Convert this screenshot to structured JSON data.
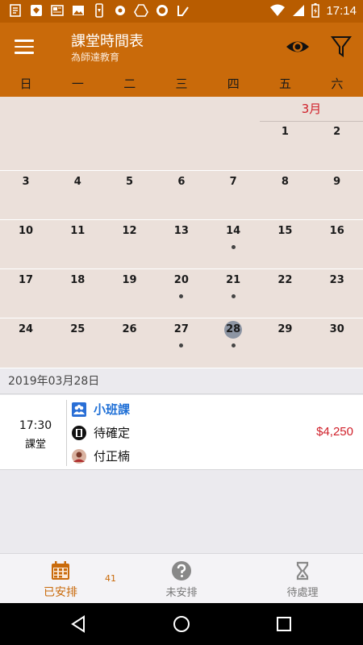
{
  "status_bar": {
    "time": "17:14",
    "icons_left": [
      "notes-icon",
      "shield-icon",
      "news-icon",
      "image-icon",
      "phone-sync-icon",
      "settings-icon",
      "drive-icon",
      "record-icon",
      "check-icon"
    ],
    "icons_right": [
      "wifi-icon",
      "signal-icon",
      "battery-charging-icon"
    ]
  },
  "app_bar": {
    "title": "課堂時間表",
    "subtitle": "為師達教育",
    "background": "#c96a0a"
  },
  "weekdays": [
    "日",
    "一",
    "二",
    "三",
    "四",
    "五",
    "六"
  ],
  "calendar": {
    "month_label": "3月",
    "weeks": [
      [
        null,
        null,
        null,
        null,
        null,
        {
          "d": "1"
        },
        {
          "d": "2"
        }
      ],
      [
        {
          "d": "3"
        },
        {
          "d": "4"
        },
        {
          "d": "5"
        },
        {
          "d": "6"
        },
        {
          "d": "7"
        },
        {
          "d": "8"
        },
        {
          "d": "9"
        }
      ],
      [
        {
          "d": "10"
        },
        {
          "d": "11"
        },
        {
          "d": "12"
        },
        {
          "d": "13"
        },
        {
          "d": "14",
          "dot": true
        },
        {
          "d": "15"
        },
        {
          "d": "16"
        }
      ],
      [
        {
          "d": "17"
        },
        {
          "d": "18"
        },
        {
          "d": "19"
        },
        {
          "d": "20",
          "dot": true
        },
        {
          "d": "21",
          "dot": true
        },
        {
          "d": "22"
        },
        {
          "d": "23"
        }
      ],
      [
        {
          "d": "24"
        },
        {
          "d": "25"
        },
        {
          "d": "26"
        },
        {
          "d": "27",
          "dot": true
        },
        {
          "d": "28",
          "dot": true,
          "today": true
        },
        {
          "d": "29"
        },
        {
          "d": "30"
        }
      ]
    ]
  },
  "selected_date": "2019年03月28日",
  "event": {
    "time": "17:30",
    "type": "課堂",
    "class_name": "小班課",
    "status": "待確定",
    "price": "$4,250",
    "teacher": "付正楠"
  },
  "bottom_nav": {
    "items": [
      {
        "label": "已安排",
        "icon": "calendar-icon",
        "active": true
      },
      {
        "label": "未安排",
        "icon": "question-icon",
        "active": false
      },
      {
        "label": "待處理",
        "icon": "hourglass-icon",
        "active": false
      }
    ],
    "badge": "41"
  },
  "colors": {
    "primary": "#c96a0a",
    "accent_red": "#d0202a",
    "link_blue": "#1e6fd6"
  }
}
